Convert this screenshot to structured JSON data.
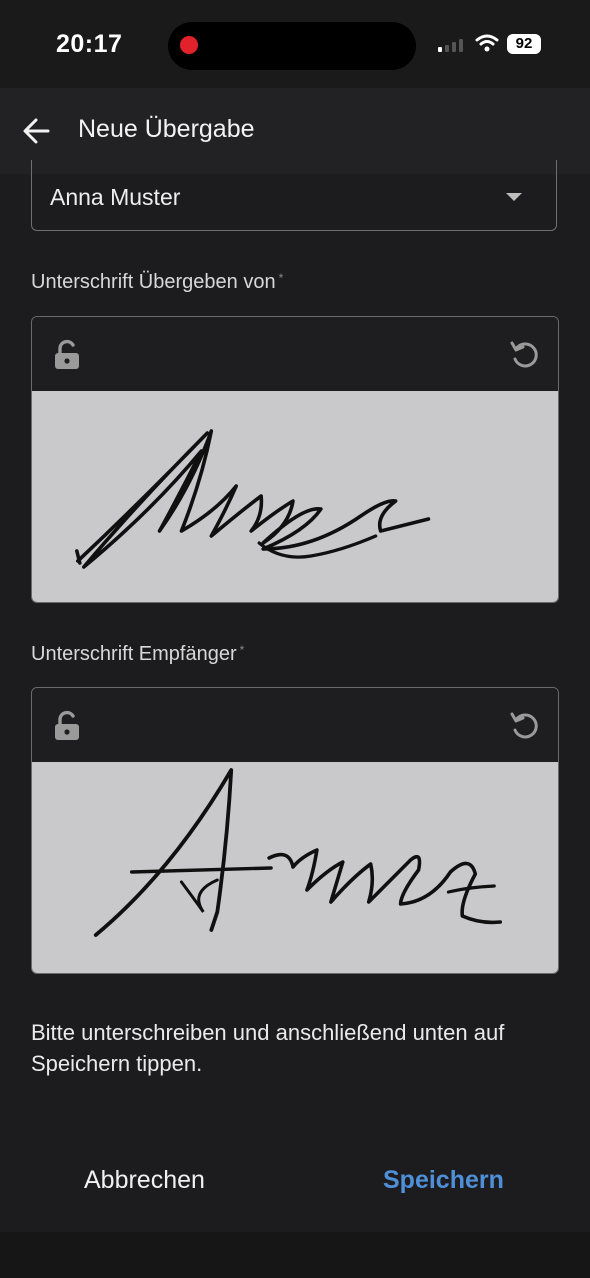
{
  "status_bar": {
    "time": "20:17",
    "battery": "92",
    "icons": [
      "recording-indicator",
      "signal-icon",
      "wifi-icon",
      "battery-icon"
    ]
  },
  "app_bar": {
    "title": "Neue Übergabe",
    "back_icon": "arrow-left-icon"
  },
  "form": {
    "dropdown_value": "Anna Muster",
    "signatures": [
      {
        "label": "Unterschrift Übergeben von",
        "required_mark": "*",
        "lock_icon": "lock-open-icon",
        "reset_icon": "reset-icon"
      },
      {
        "label": "Unterschrift Empfänger",
        "required_mark": "*",
        "lock_icon": "lock-open-icon",
        "reset_icon": "reset-icon"
      }
    ],
    "hint": "Bitte unterschreiben und anschließend unten auf Speichern tippen."
  },
  "actions": {
    "cancel": "Abbrechen",
    "save": "Speichern"
  },
  "colors": {
    "background": "#1c1c1e",
    "accent": "#4f8fd8",
    "signature_pad": "#c9c9cb",
    "recording": "#e1222b"
  }
}
